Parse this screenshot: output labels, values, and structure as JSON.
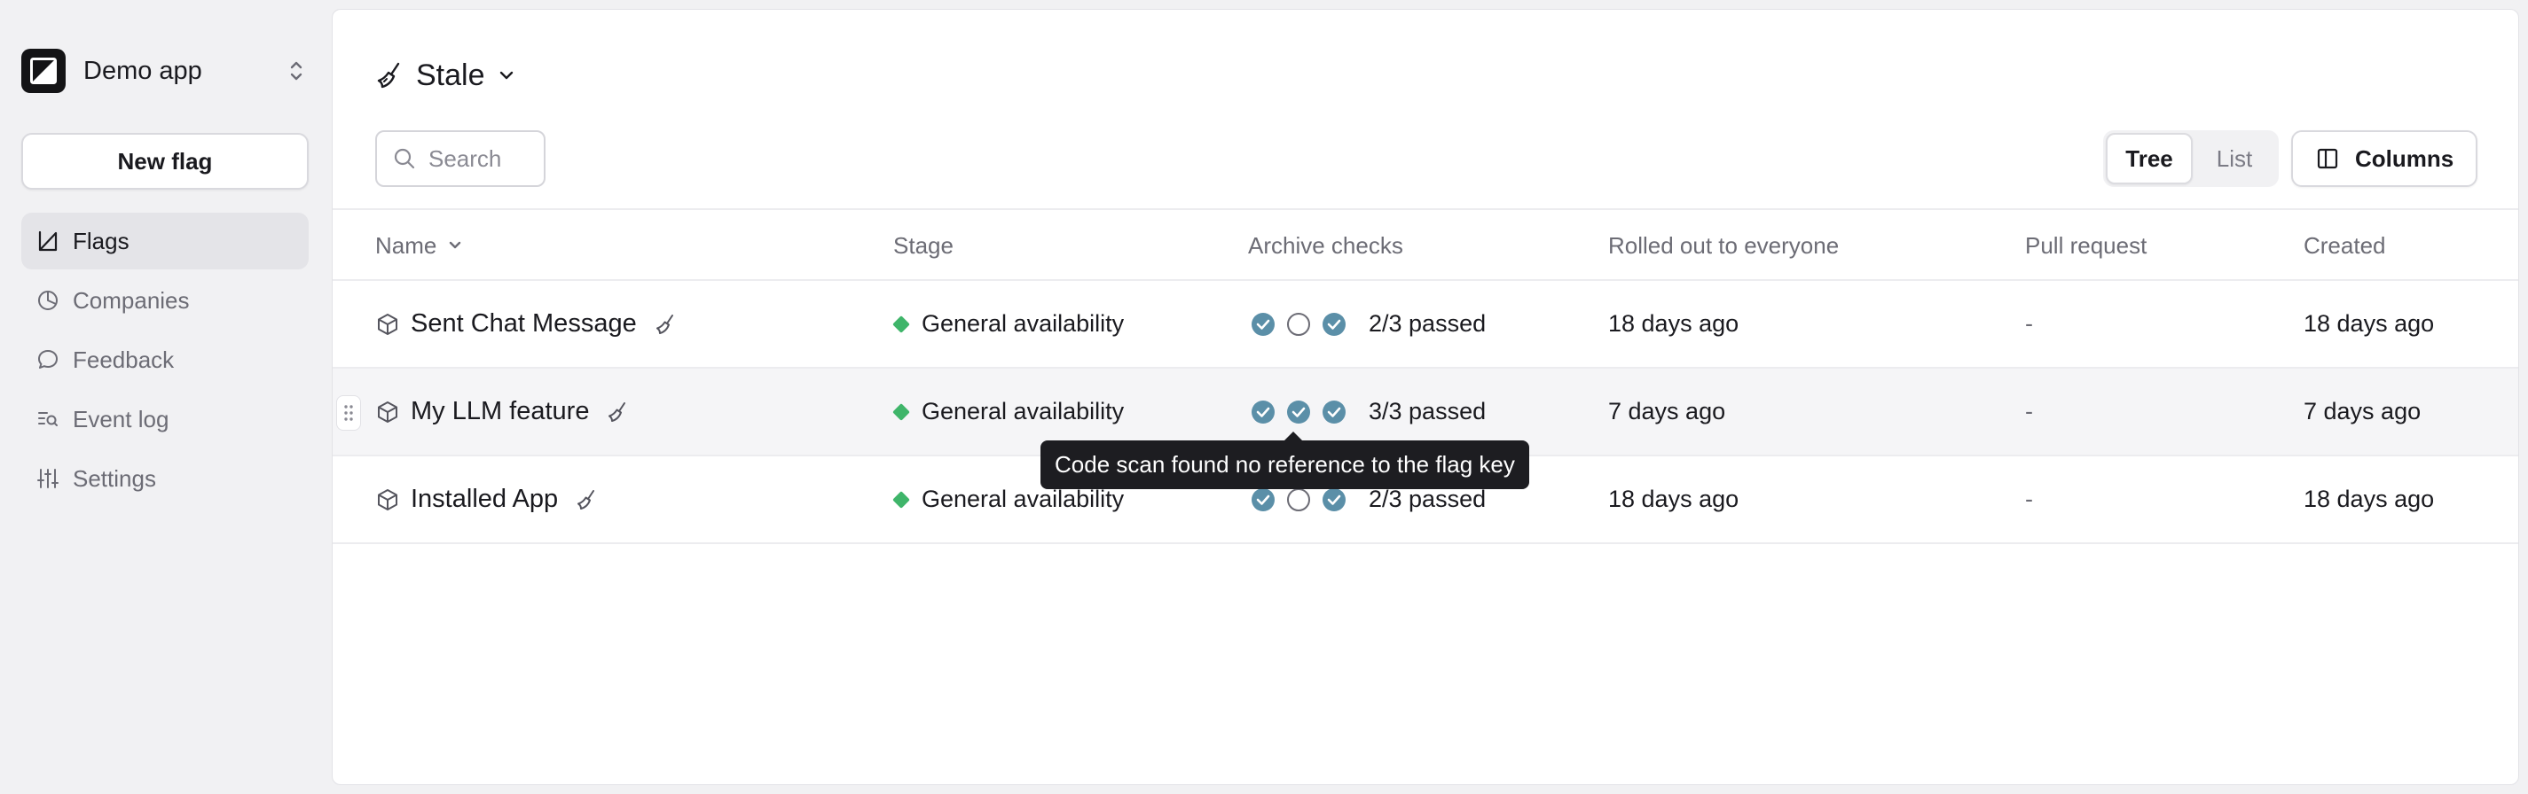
{
  "sidebar": {
    "app_name": "Demo app",
    "new_flag_label": "New flag",
    "nav": [
      {
        "label": "Flags",
        "icon": "flag-triangle-icon",
        "active": true
      },
      {
        "label": "Companies",
        "icon": "pie-chart-icon"
      },
      {
        "label": "Feedback",
        "icon": "chat-bubble-icon"
      },
      {
        "label": "Event log",
        "icon": "list-search-icon"
      },
      {
        "label": "Settings",
        "icon": "sliders-icon"
      }
    ]
  },
  "header": {
    "title": "Stale",
    "search_placeholder": "Search",
    "view_tree": "Tree",
    "view_list": "List",
    "columns_label": "Columns"
  },
  "table": {
    "columns": [
      "Name",
      "Stage",
      "Archive checks",
      "Rolled out to everyone",
      "Pull request",
      "Created"
    ],
    "rows": [
      {
        "name": "Sent Chat Message",
        "stage": "General availability",
        "checks": [
          true,
          false,
          true
        ],
        "checks_text": "2/3 passed",
        "rolled_out": "18 days ago",
        "pull_request": "-",
        "created": "18 days ago"
      },
      {
        "name": "My LLM feature",
        "stage": "General availability",
        "checks": [
          true,
          true,
          true
        ],
        "checks_text": "3/3 passed",
        "rolled_out": "7 days ago",
        "pull_request": "-",
        "created": "7 days ago"
      },
      {
        "name": "Installed App",
        "stage": "General availability",
        "checks": [
          true,
          false,
          true
        ],
        "checks_text": "2/3 passed",
        "rolled_out": "18 days ago",
        "pull_request": "-",
        "created": "18 days ago"
      }
    ]
  },
  "tooltip": {
    "text": "Code scan found no reference to the flag key"
  },
  "colors": {
    "stage_ga": "#3fb56a",
    "check_passed": "#5b8fa8",
    "accent_dark": "#141416"
  }
}
